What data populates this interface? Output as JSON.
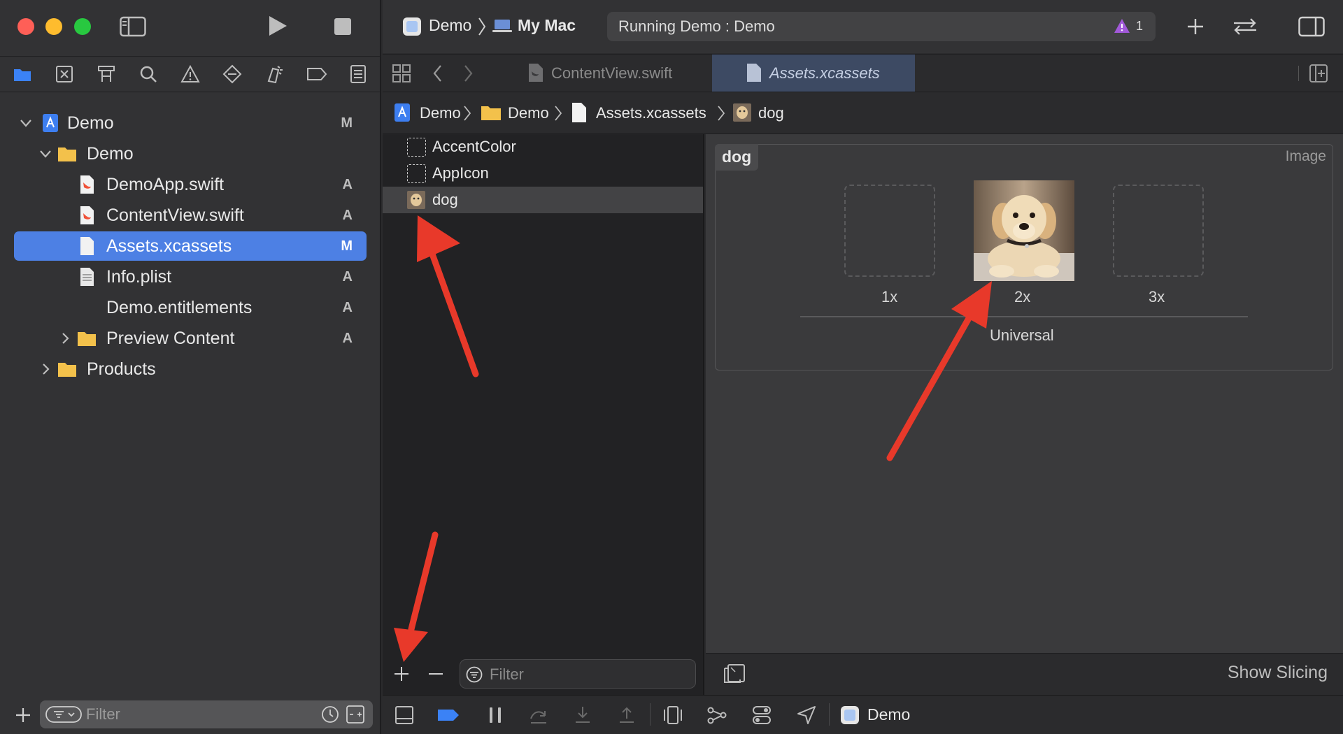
{
  "scheme": {
    "project": "Demo",
    "destination": "My Mac"
  },
  "status": {
    "text": "Running Demo : Demo",
    "warning_count": "1"
  },
  "tabs": [
    {
      "label": "ContentView.swift",
      "active": false
    },
    {
      "label": "Assets.xcassets",
      "active": true
    }
  ],
  "breadcrumb": [
    "Demo",
    "Demo",
    "Assets.xcassets",
    "dog"
  ],
  "navigator": {
    "tree": [
      {
        "label": "Demo",
        "badge": "M"
      },
      {
        "label": "Demo",
        "badge": ""
      },
      {
        "label": "DemoApp.swift",
        "badge": "A"
      },
      {
        "label": "ContentView.swift",
        "badge": "A"
      },
      {
        "label": "Assets.xcassets",
        "badge": "M"
      },
      {
        "label": "Info.plist",
        "badge": "A"
      },
      {
        "label": "Demo.entitlements",
        "badge": "A"
      },
      {
        "label": "Preview Content",
        "badge": "A"
      },
      {
        "label": "Products",
        "badge": ""
      }
    ],
    "filter_placeholder": "Filter"
  },
  "assets": {
    "items": [
      "AccentColor",
      "AppIcon",
      "dog"
    ],
    "selected": "dog",
    "filter_placeholder": "Filter"
  },
  "image_set": {
    "name": "dog",
    "type": "Image",
    "scales": [
      "1x",
      "2x",
      "3x"
    ],
    "idiom": "Universal"
  },
  "detail_footer": {
    "show_slicing": "Show Slicing"
  },
  "debug": {
    "target": "Demo"
  },
  "colors": {
    "accent": "#4d80e4",
    "close": "#fe5f57",
    "minimize": "#febc2e",
    "zoom": "#28c840",
    "annotation": "#e8392a",
    "warning": "#a259d9"
  }
}
